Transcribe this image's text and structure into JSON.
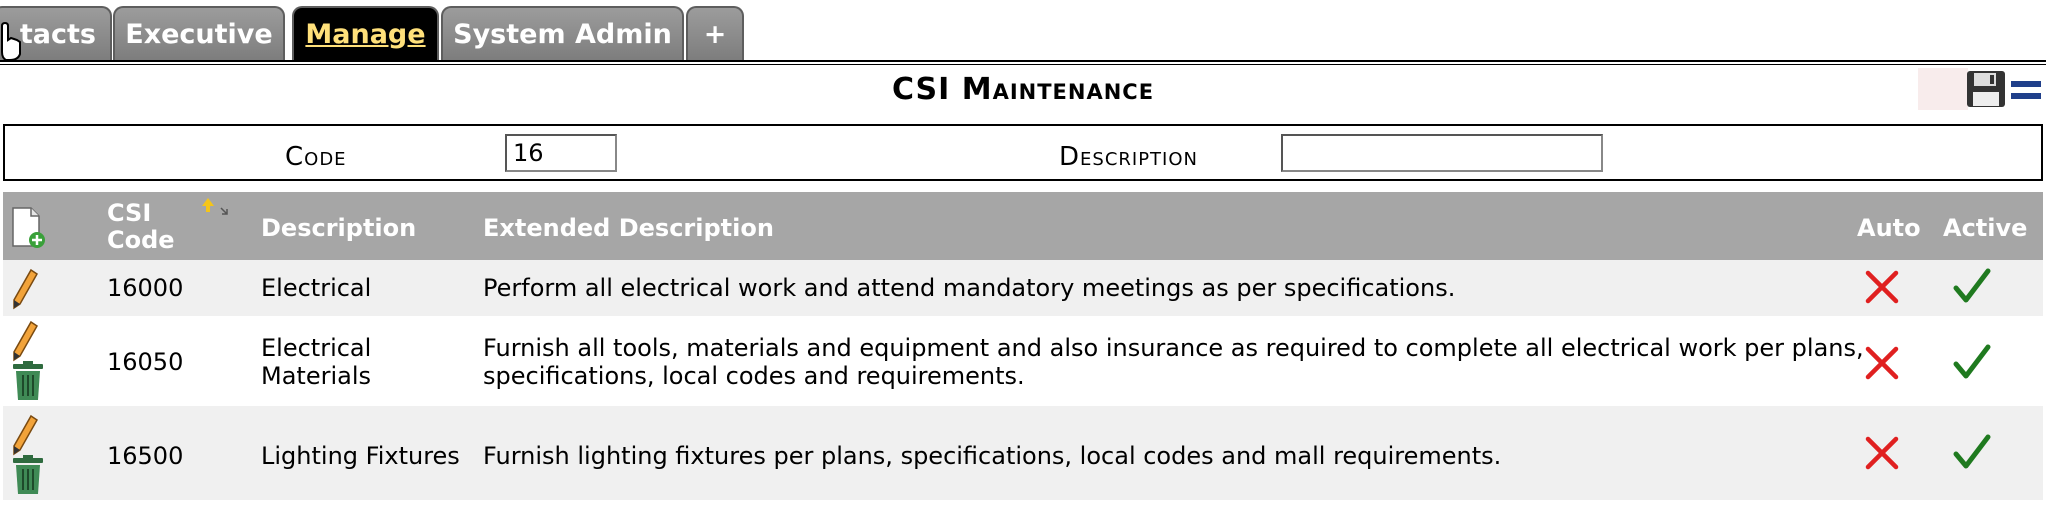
{
  "tabs": [
    {
      "label": "Contacts",
      "visible_label": "tacts",
      "active": false
    },
    {
      "label": "Executive",
      "active": false
    },
    {
      "label": "Manage",
      "active": true
    },
    {
      "label": "System Admin",
      "active": false
    },
    {
      "label": "+",
      "active": false
    }
  ],
  "page": {
    "title": "CSI Maintenance"
  },
  "filter": {
    "code_label": "Code",
    "code_value": "16",
    "description_label": "Description",
    "description_value": ""
  },
  "table": {
    "headers": {
      "csi_code_line1": "CSI",
      "csi_code_line2": "Code",
      "description": "Description",
      "extended_description": "Extended Description",
      "auto": "Auto",
      "active": "Active"
    },
    "rows": [
      {
        "code": "16000",
        "description": "Electrical",
        "description_line2": "",
        "extended": "Perform all electrical work and attend mandatory meetings as per specifications.",
        "extended_line2": "",
        "auto": false,
        "active": true,
        "deletable": false
      },
      {
        "code": "16050",
        "description": "Electrical",
        "description_line2": "Materials",
        "extended": "Furnish all tools, materials and equipment and also insurance as required to complete all electrical work per plans,",
        "extended_line2": "specifications, local codes and requirements.",
        "auto": false,
        "active": true,
        "deletable": true
      },
      {
        "code": "16500",
        "description": "Lighting Fixtures",
        "description_line2": "",
        "extended": "Furnish lighting fixtures per plans, specifications, local codes and mall requirements.",
        "extended_line2": "",
        "auto": false,
        "active": true,
        "deletable": true
      }
    ]
  },
  "colors": {
    "header_bg": "#a6a6a6",
    "row_alt_bg": "#f0f0f0",
    "false_mark": "#e02020",
    "true_mark": "#1f7a1f",
    "active_tab_text": "#ffe07a"
  }
}
